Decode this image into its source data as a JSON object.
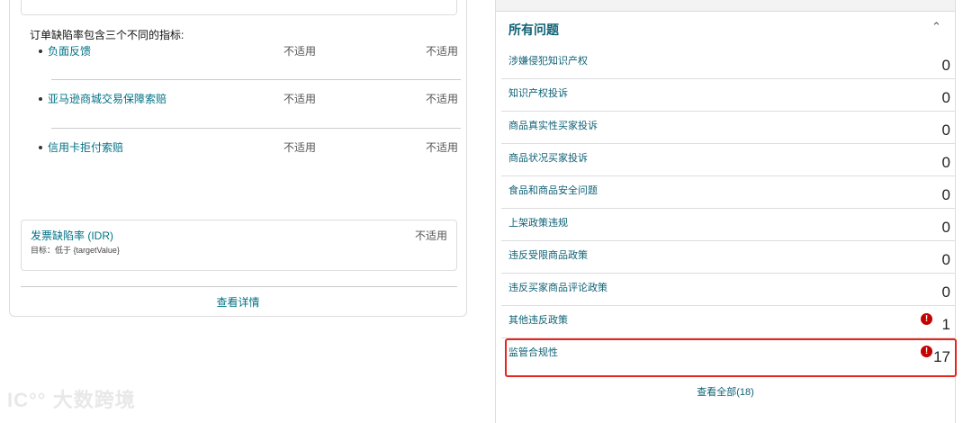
{
  "left": {
    "intro": "订单缺陷率包含三个不同的指标:",
    "metrics": [
      {
        "name": "负面反馈",
        "v1": "不适用",
        "v2": "不适用"
      },
      {
        "name": "亚马逊商城交易保障索赔",
        "v1": "不适用",
        "v2": "不适用"
      },
      {
        "name": "信用卡拒付索赔",
        "v1": "不适用",
        "v2": "不适用"
      }
    ],
    "idr": {
      "title": "发票缺陷率 (IDR)",
      "subtitle": "目标：低于 {targetValue}",
      "value": "不适用"
    },
    "details_link": "查看详情"
  },
  "right": {
    "title": "所有问题",
    "rows": [
      {
        "label": "涉嫌侵犯知识产权",
        "count": "0"
      },
      {
        "label": "知识产权投诉",
        "count": "0"
      },
      {
        "label": "商品真实性买家投诉",
        "count": "0"
      },
      {
        "label": "商品状况买家投诉",
        "count": "0"
      },
      {
        "label": "食品和商品安全问题",
        "count": "0"
      },
      {
        "label": "上架政策违规",
        "count": "0"
      },
      {
        "label": "违反受限商品政策",
        "count": "0"
      },
      {
        "label": "违反买家商品评论政策",
        "count": "0"
      },
      {
        "label": "其他违反政策",
        "count": "1",
        "warn": "!"
      },
      {
        "label": "监管合规性",
        "count": "17",
        "warn": "!"
      }
    ],
    "view_all": "查看全部(18)"
  },
  "watermark": "大数跨境",
  "colors": {
    "link": "#007185",
    "alert": "#c40000",
    "highlight": "#e5261d"
  }
}
